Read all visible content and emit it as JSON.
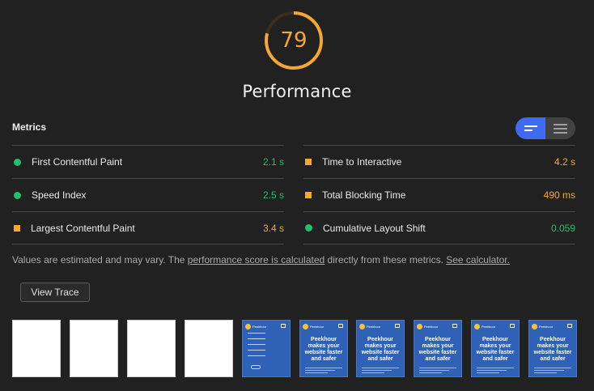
{
  "gauge": {
    "score": "79",
    "percent": 79,
    "title": "Performance",
    "color": "#f4a834",
    "track_color": "#3a2e1c"
  },
  "metrics": {
    "title": "Metrics",
    "toggle": {
      "active": "list-view",
      "options": [
        "list-view-icon",
        "text-view-icon"
      ]
    },
    "left": [
      {
        "label": "First Contentful Paint",
        "value": "2.1 s",
        "status": "pass",
        "marker": "circle"
      },
      {
        "label": "Speed Index",
        "value": "2.5 s",
        "status": "pass",
        "marker": "circle"
      },
      {
        "label": "Largest Contentful Paint",
        "value": "3.4 s",
        "status": "average",
        "marker": "square"
      }
    ],
    "right": [
      {
        "label": "Time to Interactive",
        "value": "4.2 s",
        "status": "average",
        "marker": "square"
      },
      {
        "label": "Total Blocking Time",
        "value": "490 ms",
        "status": "average",
        "marker": "square"
      },
      {
        "label": "Cumulative Layout Shift",
        "value": "0.059",
        "status": "pass",
        "marker": "circle"
      }
    ],
    "colors": {
      "pass": "#1fc16a",
      "average": "#f4a834"
    }
  },
  "footnote": {
    "text1": "Values are estimated and may vary. The ",
    "link1": "performance score is calculated",
    "text2": " directly from these metrics. ",
    "link2": "See calculator."
  },
  "trace_button": "View Trace",
  "filmstrip": {
    "brand": "Peekhour",
    "headline": "Peekhour makes your website faster and safer",
    "frames": [
      "blank",
      "blank",
      "blank",
      "blank",
      "nav",
      "site",
      "site",
      "site",
      "site",
      "site"
    ]
  }
}
